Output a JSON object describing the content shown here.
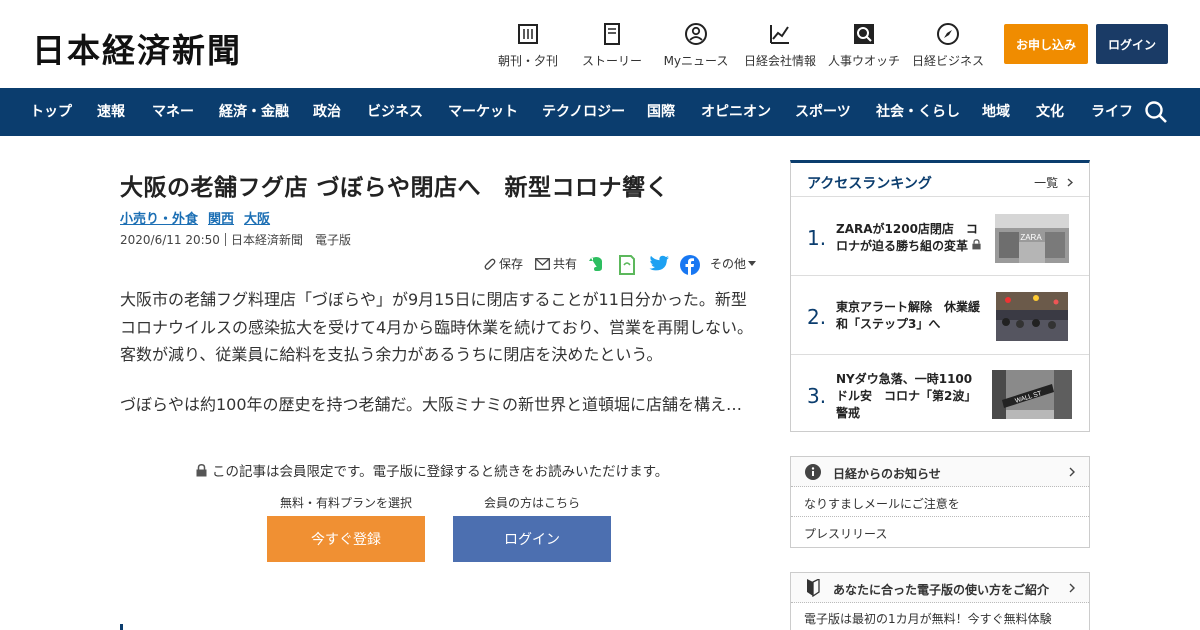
{
  "header": {
    "logo": "日本経済新聞",
    "utils": [
      {
        "label": "朝刊・夕刊",
        "icon": "newspaper-icon"
      },
      {
        "label": "ストーリー",
        "icon": "story-icon"
      },
      {
        "label": "Myニュース",
        "icon": "user-icon"
      },
      {
        "label": "日経会社情報",
        "icon": "chart-icon"
      },
      {
        "label": "人事ウオッチ",
        "icon": "search-person-icon"
      },
      {
        "label": "日経ビジネス",
        "icon": "compass-icon"
      }
    ],
    "apply_label": "お申し込み",
    "login_label": "ログイン"
  },
  "nav": {
    "items": [
      "トップ",
      "速報",
      "マネー",
      "経済・金融",
      "政治",
      "ビジネス",
      "マーケット",
      "テクノロジー",
      "国際",
      "オピニオン",
      "スポーツ",
      "社会・くらし",
      "地域",
      "文化",
      "ライフ"
    ]
  },
  "article": {
    "title": "大阪の老舗フグ店 づぼらや閉店へ　新型コロナ響く",
    "tags": [
      "小売り・外食",
      "関西",
      "大阪"
    ],
    "date": "2020/6/11 20:50",
    "source": "日本経済新聞　電子版",
    "share": {
      "save": "保存",
      "share": "共有",
      "more": "その他"
    },
    "paragraphs": [
      "大阪市の老舗フグ料理店「づぼらや」が9月15日に閉店することが11日分かった。新型コロナウイルスの感染拡大を受けて4月から臨時休業を続けており、営業を再開しない。客数が減り、従業員に給料を支払う余力があるうちに閉店を決めたという。",
      "づぼらやは約100年の歴史を持つ老舗だ。大阪ミナミの新世界と道頓堀に店舗を構え…"
    ],
    "paywall": {
      "note": "この記事は会員限定です。電子版に登録すると続きをお読みいただけます。",
      "plan_label": "無料・有料プランを選択",
      "member_label": "会員の方はこちら",
      "register_button": "今すぐ登録",
      "login_button": "ログイン"
    }
  },
  "sidebar": {
    "ranking": {
      "title": "アクセスランキング",
      "more": "一覧",
      "items": [
        {
          "num": "1.",
          "text": "ZARAが1200店閉店　コロナが迫る勝ち組の変革",
          "thumb_text": "ZARA"
        },
        {
          "num": "2.",
          "text": "東京アラート解除　休業緩和「ステップ3」へ",
          "thumb_text": ""
        },
        {
          "num": "3.",
          "text": "NYダウ急落、一時1100ドル安　コロナ「第2波」警戒",
          "thumb_text": "WALL ST"
        }
      ]
    },
    "info": {
      "title": "日経からのお知らせ",
      "items": [
        "なりすましメールにご注意を",
        "プレスリリース"
      ]
    },
    "guide": {
      "title": "あなたに合った電子版の使い方をご紹介",
      "text": "電子版は最初の1カ月が無料！今すぐ無料体験"
    }
  }
}
